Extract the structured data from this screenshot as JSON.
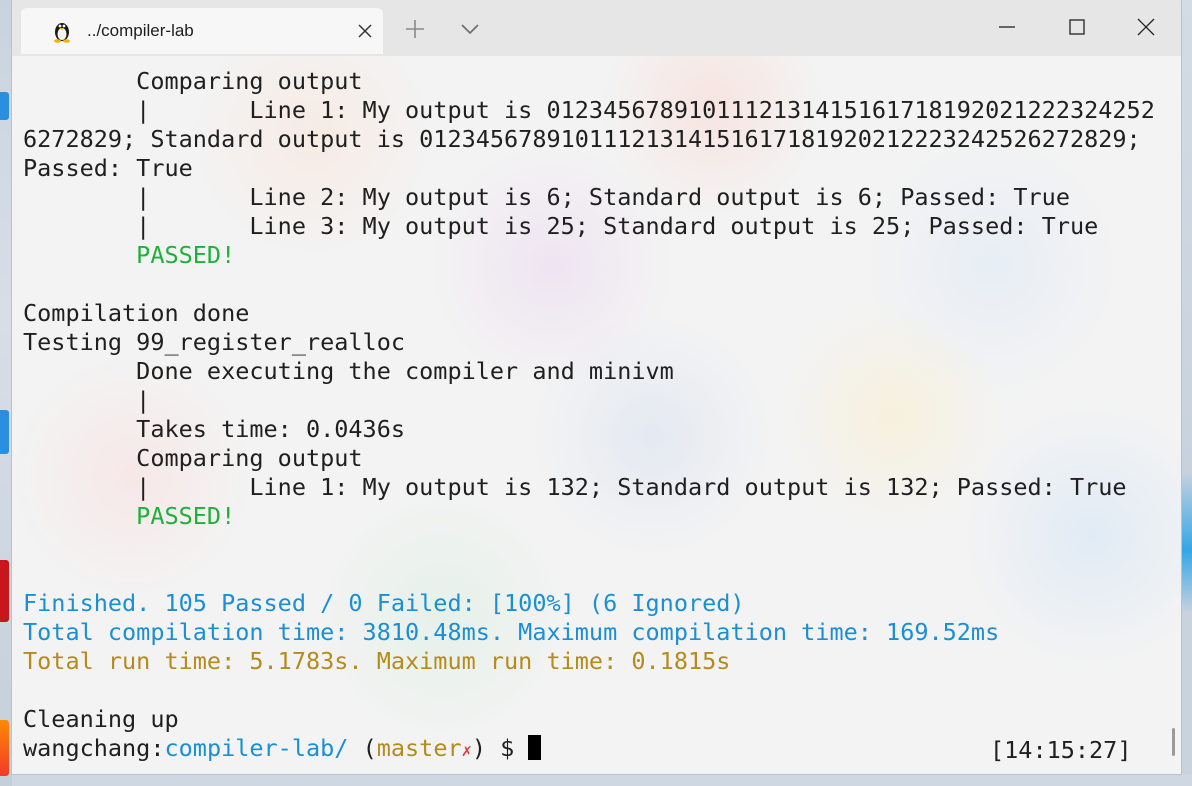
{
  "window": {
    "tab_title": "../compiler-lab",
    "tab_icon": "linux-penguin-icon"
  },
  "terminal": {
    "lines": [
      "        Comparing output",
      "        |       Line 1: My output is 0123456789101112131415161718192021222324252",
      "6272829; Standard output is 0123456789101112131415161718192021222324252627282​9;",
      "Passed: True",
      "        |       Line 2: My output is 6; Standard output is 6; Passed: True",
      "        |       Line 3: My output is 25; Standard output is 25; Passed: True",
      "        PASSED!",
      "",
      "Compilation done",
      "Testing 99_register_realloc",
      "        Done executing the compiler and minivm",
      "        |",
      "        Takes time: 0.0436s",
      "        Comparing output",
      "        |       Line 1: My output is 132; Standard output is 132; Passed: True",
      "        PASSED!",
      "",
      "",
      "Finished. 105 Passed / 0 Failed: [100%] (6 Ignored)",
      "Total compilation time: 3810.48ms. Maximum compilation time: 169.52ms",
      "Total run time: 5.1783s. Maximum run time: 0.1815s",
      "",
      "Cleaning up"
    ],
    "prompt": {
      "user": "wangchang",
      "sep": ":",
      "path": "compiler-lab/",
      "branch_open": " (",
      "branch": "master",
      "dirty_mark": "✗",
      "branch_close": ")",
      "symbol": " $ "
    },
    "clock": "[14:15:27]"
  },
  "colors": {
    "passed": "#1fb03a",
    "summary": "#1a8fd6",
    "runtime": "#b58b1c",
    "dirty": "#e23b3b"
  }
}
